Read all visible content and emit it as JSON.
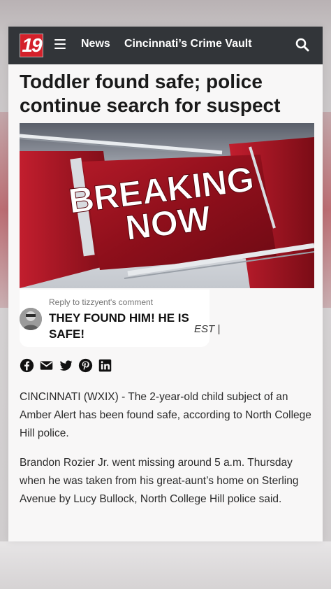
{
  "nav": {
    "logo_text": "19",
    "news_label": "News",
    "section_label": "Cincinnati’s Crime Vault",
    "brand_color": "#d4202a",
    "bar_color": "#323539"
  },
  "article": {
    "headline": "Toddler found safe; police continue search for suspect",
    "hero_text_line1": "BREAKING",
    "hero_text_line2": "NOW",
    "timestamp_fragment": "EST |",
    "paragraphs": [
      "CINCINNATI (WXIX) - The 2-year-old child subject of an Amber Alert has been found safe, according to North College Hill police.",
      "Brandon Rozier Jr. went missing around 5 a.m. Thursday when he was taken from his great-aunt’s home on Sterling Avenue by Lucy Bullock, North College Hill police said."
    ]
  },
  "comment_reply": {
    "label": "Reply to tizzyent's comment",
    "text": "THEY FOUND HIM! HE IS SAFE!"
  },
  "share": {
    "icons": [
      "facebook-icon",
      "email-icon",
      "twitter-icon",
      "pinterest-icon",
      "linkedin-icon"
    ]
  }
}
